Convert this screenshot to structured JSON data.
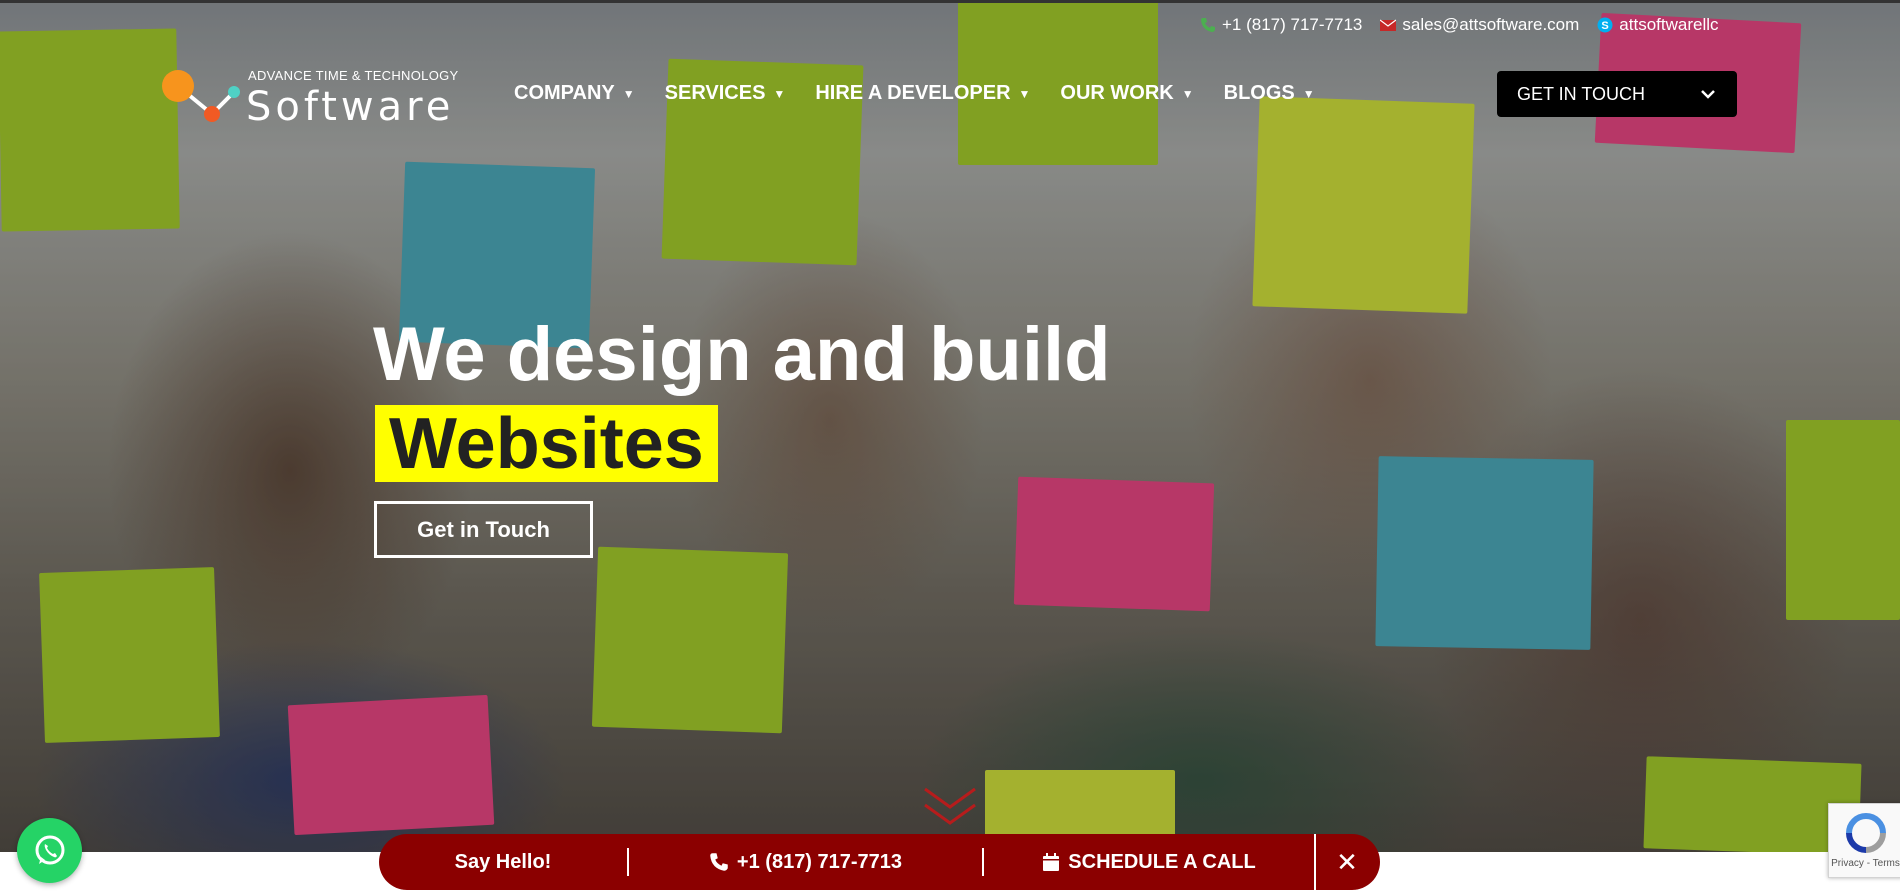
{
  "contacts": {
    "phone": "+1 (817) 717-7713",
    "email": "sales@attsoftware.com",
    "skype": "attsoftwarellc"
  },
  "logo": {
    "tagline": "ADVANCE TIME & TECHNOLOGY",
    "wordmark": "Software"
  },
  "nav": {
    "items": [
      {
        "label": "COMPANY"
      },
      {
        "label": "SERVICES"
      },
      {
        "label": "HIRE A DEVELOPER"
      },
      {
        "label": "OUR WORK"
      },
      {
        "label": "BLOGS"
      }
    ],
    "get_in_touch": "GET IN TOUCH"
  },
  "hero": {
    "headline": "We design and build",
    "highlight": "Websites",
    "cta": "Get in Touch"
  },
  "cta_bar": {
    "say_hello": "Say Hello!",
    "phone": "+1 (817) 717-7713",
    "schedule": "SCHEDULE A CALL",
    "close": "✕"
  },
  "recaptcha": {
    "terms": "Privacy - Terms"
  },
  "colors": {
    "brand_red": "#8b0000",
    "highlight_yellow": "#ffff00",
    "whatsapp_green": "#25d366"
  },
  "icons": [
    "phone-icon",
    "envelope-icon",
    "skype-icon",
    "chevron-down-icon",
    "calendar-icon",
    "whatsapp-icon",
    "recaptcha-icon",
    "close-icon"
  ]
}
